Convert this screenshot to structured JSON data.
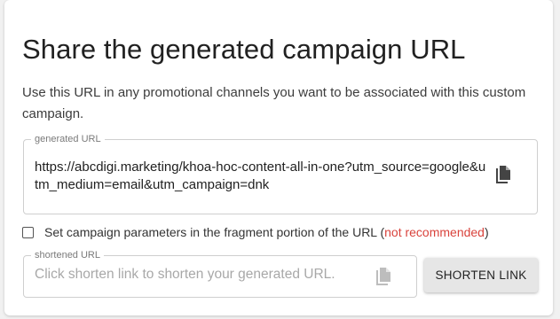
{
  "card": {
    "title": "Share the generated campaign URL",
    "description": "Use this URL in any promotional channels you want to be associated with this custom campaign."
  },
  "generated_url": {
    "legend": "generated URL",
    "value": "https://abcdigi.marketing/khoa-hoc-content-all-in-one?utm_source=google&utm_medium=email&utm_campaign=dnk",
    "copy_icon": "copy-icon"
  },
  "fragment_option": {
    "checked": false,
    "label": "Set campaign parameters in the fragment portion of the URL (",
    "warning": "not recommended",
    "label_end": ")"
  },
  "shortened_url": {
    "legend": "shortened URL",
    "placeholder": "Click shorten link to shorten your generated URL.",
    "value": "",
    "copy_icon": "copy-icon"
  },
  "shorten_button": {
    "label": "SHORTEN LINK"
  },
  "colors": {
    "warning": "#d9433c",
    "icon": "#444444",
    "icon_disabled": "#bdbdbd",
    "button_bg": "#e6e6e6"
  }
}
